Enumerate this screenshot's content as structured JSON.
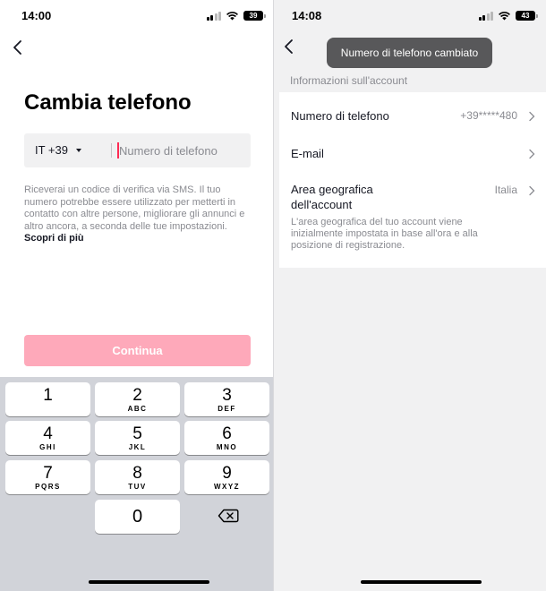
{
  "left": {
    "status": {
      "time": "14:00",
      "battery": "39"
    },
    "title": "Cambia telefono",
    "country_code": "IT +39",
    "phone_placeholder": "Numero di telefono",
    "info_text": "Riceverai un codice di verifica via SMS. Il tuo numero potrebbe essere utilizzato per metterti in contatto con altre persone, migliorare gli annunci e altro ancora, a seconda delle tue impostazioni.",
    "info_link": "Scopri di più",
    "continue_label": "Continua",
    "keypad": [
      {
        "digit": "1",
        "letters": ""
      },
      {
        "digit": "2",
        "letters": "ABC"
      },
      {
        "digit": "3",
        "letters": "DEF"
      },
      {
        "digit": "4",
        "letters": "GHI"
      },
      {
        "digit": "5",
        "letters": "JKL"
      },
      {
        "digit": "6",
        "letters": "MNO"
      },
      {
        "digit": "7",
        "letters": "PQRS"
      },
      {
        "digit": "8",
        "letters": "TUV"
      },
      {
        "digit": "9",
        "letters": "WXYZ"
      },
      {
        "digit": "0",
        "letters": ""
      }
    ]
  },
  "right": {
    "status": {
      "time": "14:08",
      "battery": "43"
    },
    "toast": "Numero di telefono cambiato",
    "section_label": "Informazioni sull'account",
    "rows": [
      {
        "label": "Numero di telefono",
        "value": "+39*****480"
      },
      {
        "label": "E-mail",
        "value": ""
      },
      {
        "label": "Area geografica dell'account",
        "value": "Italia"
      }
    ],
    "region_note": "L'area geografica del tuo account viene inizialmente impostata in base all'ora e alla posizione di registrazione."
  },
  "colors": {
    "accent": "#fe2c55",
    "continue_disabled": "#fea9ba",
    "toast_bg": "#58585a",
    "secondary_text": "#8a8b91",
    "keypad_bg": "#d1d3d9"
  },
  "icons": [
    "back-chevron-icon",
    "cellular-signal-icon",
    "wifi-icon",
    "battery-icon",
    "dropdown-caret-icon",
    "backspace-icon",
    "chevron-right-icon"
  ]
}
